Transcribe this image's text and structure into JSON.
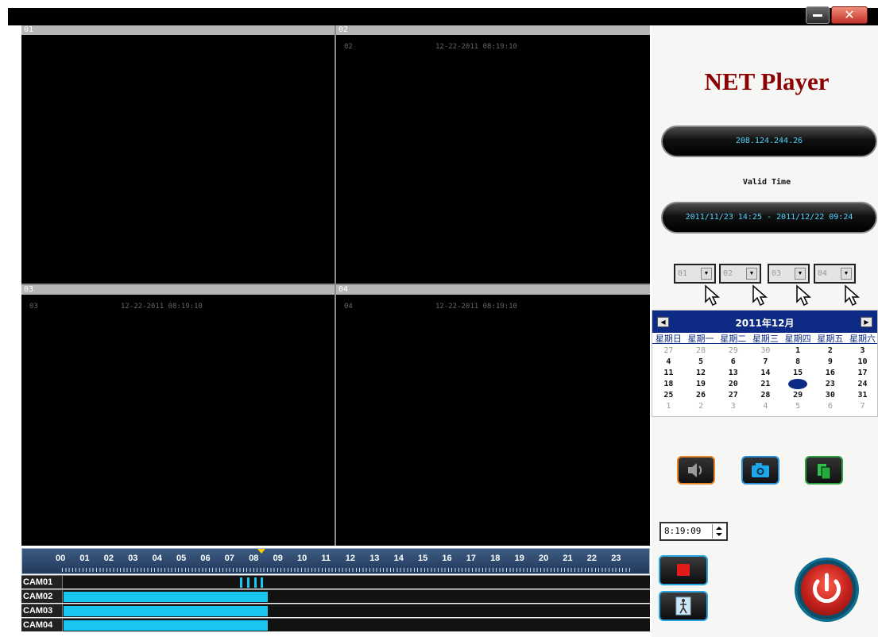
{
  "window": {
    "minimize_label": "—",
    "close_label": "✕"
  },
  "app": {
    "title": "NET Player"
  },
  "server": {
    "address": "208.124.244.26"
  },
  "validity": {
    "label": "Valid Time",
    "range": "2011/11/23 14:25 - 2011/12/22 09:24"
  },
  "channels": [
    {
      "id": "01",
      "osd_id": "",
      "osd_time": ""
    },
    {
      "id": "02",
      "osd_id": "02",
      "osd_time": "12-22-2011 08:19:10"
    },
    {
      "id": "03",
      "osd_id": "03",
      "osd_time": "12-22-2011 08:19:10"
    },
    {
      "id": "04",
      "osd_id": "04",
      "osd_time": "12-22-2011 08:19:10"
    }
  ],
  "channel_selectors": [
    "01",
    "02",
    "03",
    "04"
  ],
  "calendar": {
    "title": "2011年12月",
    "weekdays": [
      "星期日",
      "星期一",
      "星期二",
      "星期三",
      "星期四",
      "星期五",
      "星期六"
    ],
    "selected_day": "22",
    "weeks": [
      [
        "27",
        "28",
        "29",
        "30",
        "1",
        "2",
        "3"
      ],
      [
        "4",
        "5",
        "6",
        "7",
        "8",
        "9",
        "10"
      ],
      [
        "11",
        "12",
        "13",
        "14",
        "15",
        "16",
        "17"
      ],
      [
        "18",
        "19",
        "20",
        "21",
        "22",
        "23",
        "24"
      ],
      [
        "25",
        "26",
        "27",
        "28",
        "29",
        "30",
        "31"
      ],
      [
        "1",
        "2",
        "3",
        "4",
        "5",
        "6",
        "7"
      ]
    ]
  },
  "timeline": {
    "hours": [
      "00",
      "01",
      "02",
      "03",
      "04",
      "05",
      "06",
      "07",
      "08",
      "09",
      "10",
      "11",
      "12",
      "13",
      "14",
      "15",
      "16",
      "17",
      "18",
      "19",
      "20",
      "21",
      "22",
      "23"
    ],
    "current_hour": 8.33,
    "tracks": [
      {
        "label": "CAM01",
        "segments": [
          [
            7.3,
            7.38
          ],
          [
            7.6,
            7.68
          ],
          [
            7.88,
            7.96
          ],
          [
            8.16,
            8.24
          ]
        ]
      },
      {
        "label": "CAM02",
        "segments": [
          [
            0,
            8.45
          ]
        ]
      },
      {
        "label": "CAM03",
        "segments": [
          [
            0,
            8.45
          ]
        ]
      },
      {
        "label": "CAM04",
        "segments": [
          [
            0,
            8.45
          ]
        ]
      }
    ]
  },
  "playback": {
    "time": "8:19:09"
  },
  "icons": {
    "mute": "speaker-muted-icon",
    "snapshot": "camera-icon",
    "copy": "copy-icon",
    "stop": "stop-icon",
    "walker": "walking-person-icon",
    "power": "power-icon"
  },
  "colors": {
    "title": "#8b0000",
    "accent": "#18c6f0",
    "calendar_header": "#0d2a84"
  }
}
